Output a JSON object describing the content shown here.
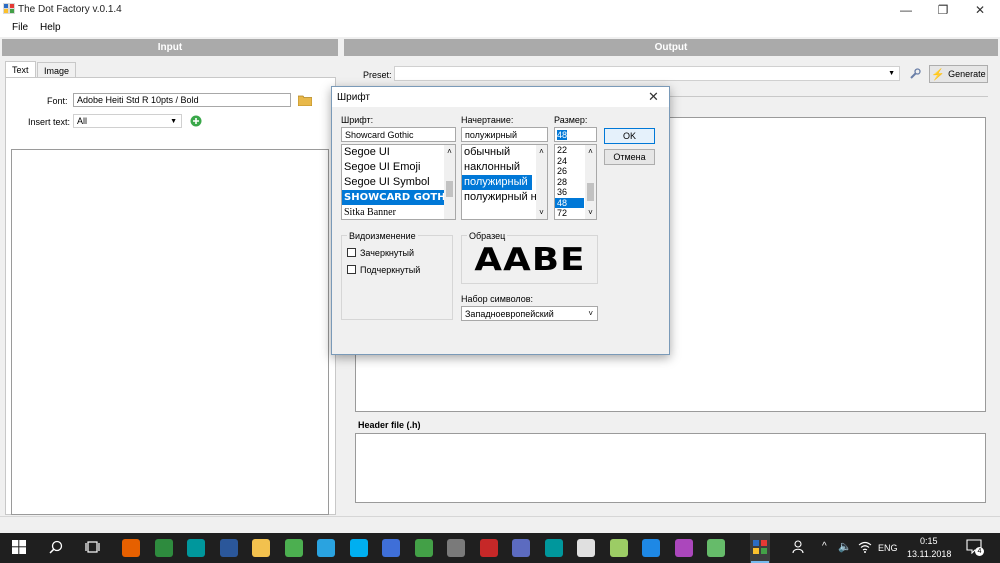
{
  "window": {
    "title": "The Dot Factory v.0.1.4",
    "minimize": "—",
    "restore": "❐",
    "close": "✕"
  },
  "menu": {
    "file": "File",
    "help": "Help"
  },
  "input_panel": {
    "header": "Input",
    "tabs": [
      {
        "label": "Text"
      },
      {
        "label": "Image"
      }
    ],
    "font_label": "Font:",
    "font_value": "Adobe Heiti Std R 10pts / Bold",
    "insert_label": "Insert text:",
    "insert_value": "All"
  },
  "output_panel": {
    "header": "Output",
    "preset_label": "Preset:",
    "preset_value": "",
    "generate_label": "Generate",
    "header_file_label": "Header file (.h)"
  },
  "font_dialog": {
    "title": "Шрифт",
    "font_label": "Шрифт:",
    "font_value": "Showcard Gothic",
    "fonts": [
      "Segoe UI",
      "Segoe UI Emoji",
      "Segoe UI Symbol",
      "SHOWCARD GOTH",
      "Sitka Banner"
    ],
    "style_label": "Начертание:",
    "style_value": "полужирный",
    "styles": [
      "обычный",
      "наклонный",
      "полужирный",
      "полужирный н"
    ],
    "size_label": "Размер:",
    "size_value": "48",
    "sizes": [
      "22",
      "24",
      "26",
      "28",
      "36",
      "48",
      "72"
    ],
    "ok": "OK",
    "cancel": "Отмена",
    "effects_label": "Видоизменение",
    "strikeout": "Зачеркнутый",
    "underline": "Подчеркнутый",
    "sample_label": "Образец",
    "sample_text": "AABE",
    "charset_label": "Набор символов:",
    "charset_value": "Западноевропейский"
  },
  "taskbar": {
    "lang": "ENG",
    "time": "0:15",
    "date": "13.11.2018",
    "notifications": "4",
    "icon_colors": [
      "#e66000",
      "#2e8b3e",
      "#00979c",
      "#2b579a",
      "#f2c14e",
      "#4caf50",
      "#2aa3e0",
      "#00aff0",
      "#3f6fd8",
      "#43a047",
      "#7a7a7a",
      "#c62828",
      "#5c6bc0",
      "#00979c",
      "#e0e0e0",
      "#9ccc65",
      "#1e88e5",
      "#ab47bc",
      "#66bb6a",
      "#ffb300"
    ]
  }
}
